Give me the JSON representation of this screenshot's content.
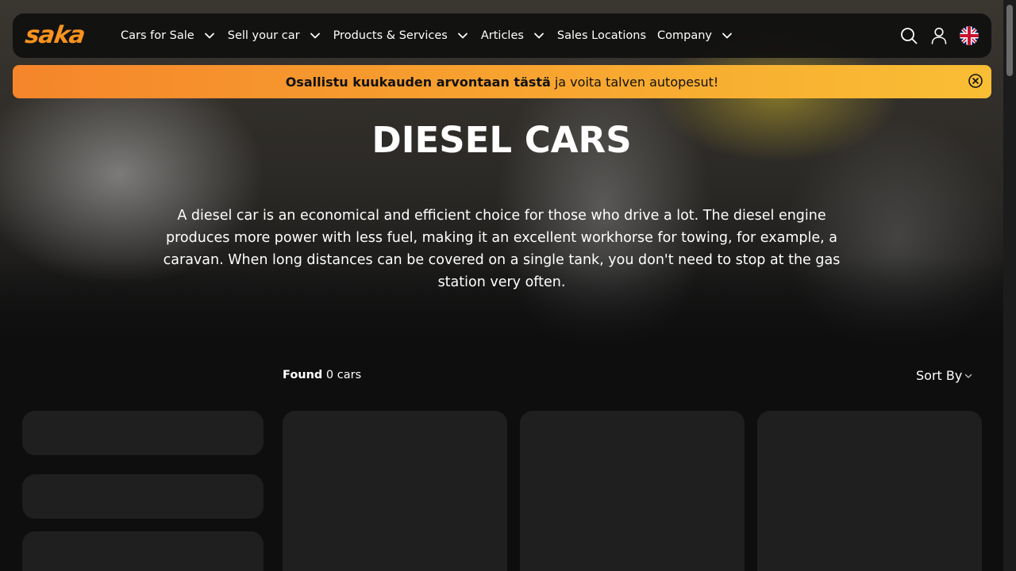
{
  "brand": {
    "logo_text": "saka",
    "accent": "#f7931e"
  },
  "nav": {
    "items": [
      {
        "label": "Cars for Sale",
        "has_dropdown": true
      },
      {
        "label": "Sell your car",
        "has_dropdown": true
      },
      {
        "label": "Products & Services",
        "has_dropdown": true
      },
      {
        "label": "Articles",
        "has_dropdown": true
      },
      {
        "label": "Sales Locations",
        "has_dropdown": false
      },
      {
        "label": "Company",
        "has_dropdown": true
      }
    ],
    "icons": [
      "search-icon",
      "user-icon",
      "uk-flag-icon"
    ]
  },
  "banner": {
    "bold_text": "Osallistu kuukauden arvontaan tästä",
    "text": "ja voita talven autopesut!",
    "close_icon": "close-circle-icon",
    "gradient_start": "#f5852b",
    "gradient_end": "#f9be34"
  },
  "hero": {
    "title": "DIESEL CARS",
    "description": "A diesel car is an economical and efficient choice for those who drive a lot. The diesel engine produces more power with less fuel, making it an excellent workhorse for towing, for example, a caravan. When long distances can be covered on a single tank, you don't need to stop at the gas station very often."
  },
  "results": {
    "found_label": "Found",
    "found_count_text": "0 cars",
    "sort_label": "Sort By"
  }
}
